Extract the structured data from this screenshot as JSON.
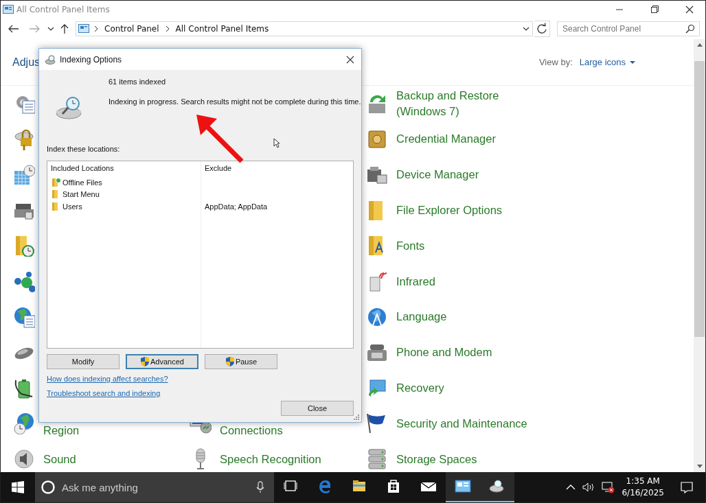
{
  "window": {
    "title": "All Control Panel Items"
  },
  "address_bar": {
    "breadcrumb": [
      "Control Panel",
      "All Control Panel Items"
    ],
    "search": {
      "placeholder": "Search Control Panel"
    }
  },
  "header": {
    "title": "Adjus",
    "view_by_label": "View by:",
    "view_by_value": "Large icons"
  },
  "columns": [
    {
      "items": [
        {
          "kind": "icon"
        },
        {
          "kind": "icon"
        },
        {
          "kind": "icon"
        },
        {
          "kind": "icon"
        },
        {
          "kind": "icon"
        },
        {
          "kind": "icon"
        },
        {
          "kind": "icon"
        },
        {
          "kind": "icon"
        },
        {
          "kind": "icon"
        },
        {
          "kind": "partial",
          "label": "Region"
        },
        {
          "kind": "entry",
          "label": "Sound"
        }
      ]
    },
    {
      "items": [
        {
          "kind": "partial",
          "label": "Connections"
        },
        {
          "kind": "entry",
          "label": "Speech Recognition"
        }
      ]
    },
    {
      "items": [
        {
          "kind": "entry",
          "label": "Backup and Restore (Windows 7)"
        },
        {
          "kind": "entry",
          "label": "Credential Manager"
        },
        {
          "kind": "entry",
          "label": "Device Manager"
        },
        {
          "kind": "entry",
          "label": "File Explorer Options"
        },
        {
          "kind": "entry",
          "label": "Fonts"
        },
        {
          "kind": "entry",
          "label": "Infrared"
        },
        {
          "kind": "entry",
          "label": "Language"
        },
        {
          "kind": "entry",
          "label": "Phone and Modem"
        },
        {
          "kind": "entry",
          "label": "Recovery"
        },
        {
          "kind": "entry",
          "label": "Security and Maintenance"
        },
        {
          "kind": "entry",
          "label": "Storage Spaces"
        }
      ]
    }
  ],
  "dialog": {
    "title": "Indexing Options",
    "count": "61 items indexed",
    "status": "Indexing in progress. Search results might not be complete during this time.",
    "locations_label": "Index these locations:",
    "columns": [
      "Included Locations",
      "Exclude"
    ],
    "rows": [
      {
        "location": "Offline Files",
        "kind": "synced"
      },
      {
        "location": "Start Menu",
        "kind": "folder"
      },
      {
        "location": "Users",
        "exclude": "AppData; AppData",
        "kind": "folder"
      }
    ],
    "buttons": [
      {
        "label": "Modify",
        "shield": false,
        "focused": false
      },
      {
        "label": "Advanced",
        "shield": true,
        "focused": true
      },
      {
        "label": "Pause",
        "shield": true,
        "focused": false
      }
    ],
    "links": [
      "How does indexing affect searches?",
      "Troubleshoot search and indexing"
    ],
    "close_button": "Close"
  },
  "taskbar": {
    "search_placeholder": "Ask me anything",
    "apps": [
      {
        "kind": "task-view",
        "active": false
      },
      {
        "kind": "edge",
        "active": false
      },
      {
        "kind": "explorer",
        "active": false
      },
      {
        "kind": "store",
        "active": false
      },
      {
        "kind": "mail",
        "active": false
      },
      {
        "kind": "control-panel",
        "active": true
      },
      {
        "kind": "indexing",
        "active": true
      }
    ],
    "time": "1:35 AM",
    "date": "6/16/2025"
  }
}
